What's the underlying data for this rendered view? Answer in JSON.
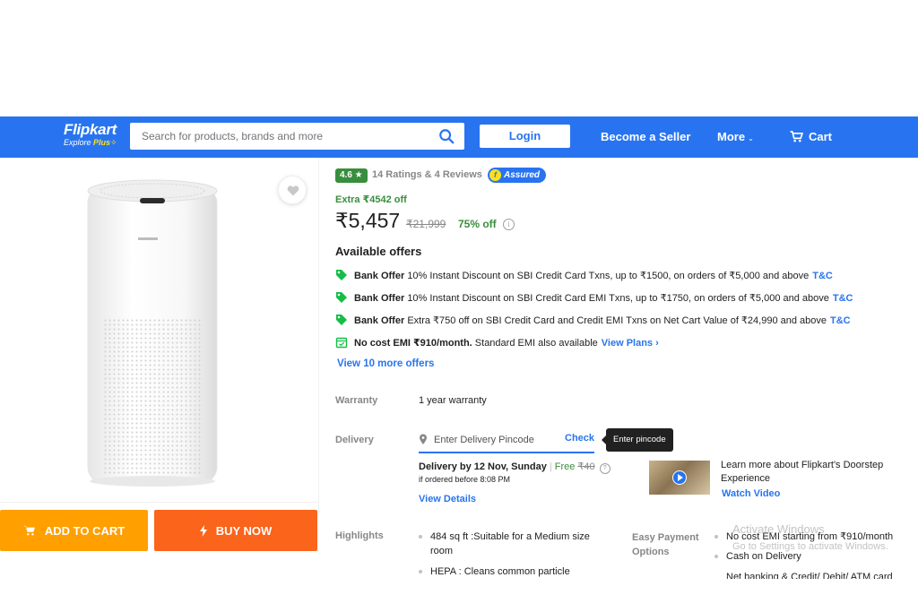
{
  "header": {
    "logo": {
      "brand": "Flipkart",
      "tagline_prefix": "Explore",
      "tagline_plus": "Plus"
    },
    "search": {
      "placeholder": "Search for products, brands and more"
    },
    "login_label": "Login",
    "seller_label": "Become a Seller",
    "more_label": "More",
    "cart_label": "Cart"
  },
  "product": {
    "rating": "4.6",
    "ratings_text": "14 Ratings & 4 Reviews",
    "assured_label": "Assured",
    "extra_off": "Extra ₹4542 off",
    "price": "₹5,457",
    "mrp": "₹21,999",
    "discount": "75% off"
  },
  "offers": {
    "title": "Available offers",
    "items": [
      {
        "kind": "Bank Offer",
        "text": "10% Instant Discount on SBI Credit Card Txns, up to ₹1500, on orders of ₹5,000 and above",
        "link": "T&C"
      },
      {
        "kind": "Bank Offer",
        "text": "10% Instant Discount on SBI Credit Card EMI Txns, up to ₹1750, on orders of ₹5,000 and above",
        "link": "T&C"
      },
      {
        "kind": "Bank Offer",
        "text": "Extra ₹750 off on SBI Credit Card and Credit EMI Txns on Net Cart Value of ₹24,990 and above",
        "link": "T&C"
      },
      {
        "kind": "No cost EMI ₹910/month.",
        "text": "Standard EMI also available",
        "link": "View Plans ›"
      }
    ],
    "more_link": "View 10 more offers"
  },
  "warranty": {
    "label": "Warranty",
    "value": "1 year warranty"
  },
  "delivery": {
    "label": "Delivery",
    "pincode_placeholder": "Enter Delivery Pincode",
    "check_label": "Check",
    "tooltip": "Enter pincode",
    "date": "Delivery by 12 Nov, Sunday",
    "free_label": "Free",
    "free_strike": "₹40",
    "ordered_before": "if ordered before 8:08 PM",
    "view_details": "View Details",
    "learn_more": "Learn more about Flipkart's Doorstep Experience",
    "watch_video": "Watch Video"
  },
  "highlights": {
    "label": "Highlights",
    "items": [
      "484 sq ft :Suitable for a Medium size room",
      "HEPA : Cleans common particle"
    ]
  },
  "payment": {
    "label": "Easy Payment Options",
    "items": [
      "No cost EMI starting from ₹910/month",
      "Cash on Delivery",
      "Net banking & Credit/ Debit/ ATM card"
    ]
  },
  "actions": {
    "add_to_cart": "ADD TO CART",
    "buy_now": "BUY NOW"
  },
  "watermark": {
    "title": "Activate Windows",
    "subtitle": "Go to Settings to activate Windows."
  },
  "colors": {
    "brand_blue": "#2874f0",
    "add_to_cart": "#ff9f00",
    "buy_now": "#fb641b",
    "rating_green": "#388e3c"
  }
}
